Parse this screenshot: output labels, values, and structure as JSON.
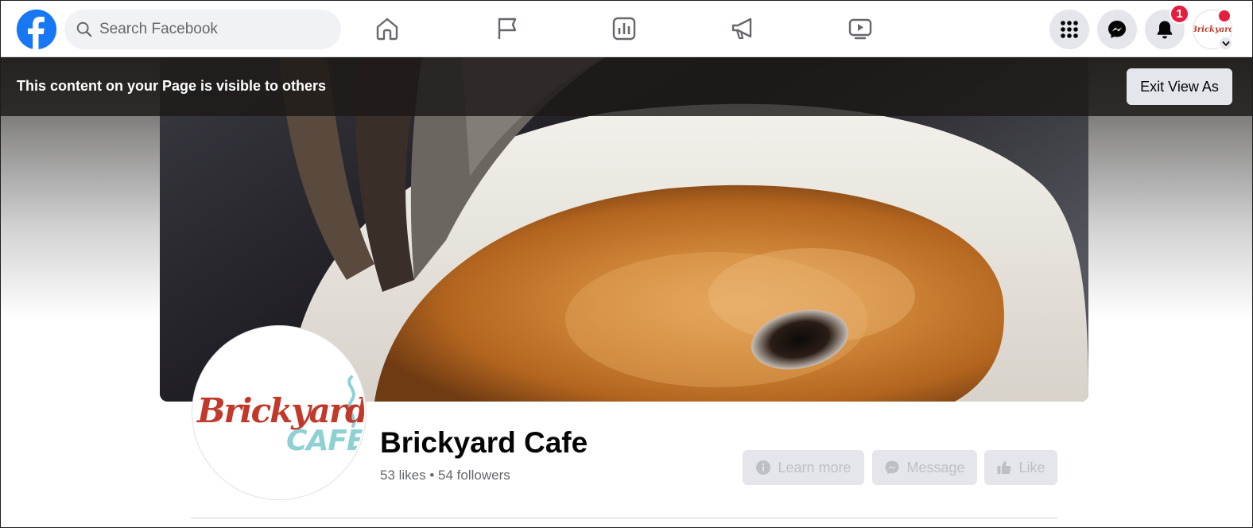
{
  "topnav": {
    "logo_icon": "facebook-logo-icon",
    "search": {
      "placeholder": "Search Facebook",
      "value": "",
      "icon": "search-icon"
    },
    "tabs": [
      {
        "id": "home",
        "icon": "home-icon"
      },
      {
        "id": "pages",
        "icon": "flag-icon"
      },
      {
        "id": "insights",
        "icon": "chart-icon"
      },
      {
        "id": "ads",
        "icon": "megaphone-icon"
      },
      {
        "id": "watch",
        "icon": "video-icon"
      }
    ],
    "right": {
      "menu_icon": "grid-menu-icon",
      "messenger_icon": "messenger-icon",
      "notifications_icon": "bell-icon",
      "notifications_count": "1",
      "account_label": "Brickyard"
    }
  },
  "banner": {
    "text": "This content on your Page is visible to others",
    "exit_label": "Exit View As"
  },
  "profile": {
    "logo_main": "Brickyard",
    "logo_sub": "CAFE",
    "name": "Brickyard Cafe",
    "stats": "53 likes • 54 followers"
  },
  "actions": {
    "learn_more": "Learn more",
    "message": "Message",
    "like": "Like"
  },
  "colors": {
    "brand_blue": "#1877f2",
    "badge_red": "#e41e3f",
    "button_grey": "#e4e6eb",
    "logo_red": "#c0392b",
    "logo_teal": "#8ed1d3"
  }
}
